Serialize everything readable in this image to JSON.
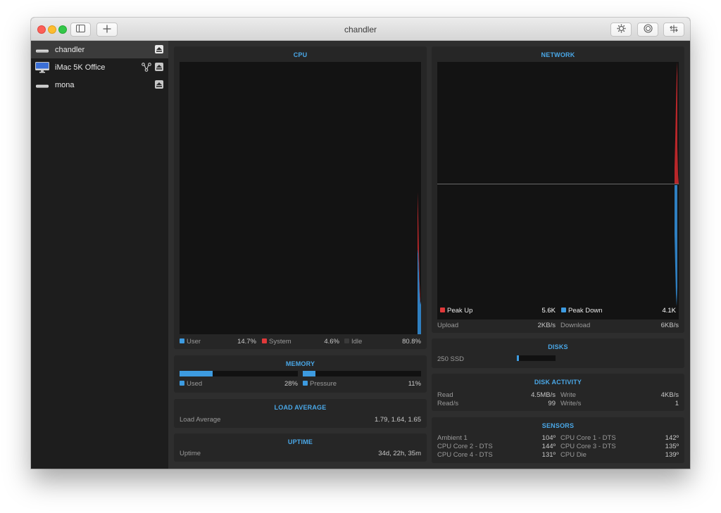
{
  "window": {
    "title": "chandler"
  },
  "sidebar": {
    "hosts": [
      {
        "name": "chandler",
        "selected": true
      },
      {
        "name": "iMac 5K Office",
        "selected": false
      },
      {
        "name": "mona",
        "selected": false
      }
    ]
  },
  "colors": {
    "accent": "#4aa8e8",
    "up_red": "#e0393a",
    "down_blue": "#3d9be0",
    "idle": "#3a3a3a"
  },
  "cpu": {
    "title": "CPU",
    "user_label": "User",
    "user_value": "14.7%",
    "system_label": "System",
    "system_value": "4.6%",
    "idle_label": "Idle",
    "idle_value": "80.8%"
  },
  "memory": {
    "title": "MEMORY",
    "used_label": "Used",
    "used_value": "28%",
    "used_fraction": 0.28,
    "pressure_label": "Pressure",
    "pressure_value": "11%",
    "pressure_fraction": 0.11
  },
  "load": {
    "title": "LOAD AVERAGE",
    "label": "Load Average",
    "value": "1.79, 1.64, 1.65"
  },
  "uptime": {
    "title": "UPTIME",
    "label": "Uptime",
    "value": "34d, 22h, 35m"
  },
  "network": {
    "title": "NETWORK",
    "peak_up_label": "Peak Up",
    "peak_up_value": "5.6K",
    "peak_down_label": "Peak Down",
    "peak_down_value": "4.1K",
    "upload_label": "Upload",
    "upload_value": "2KB/s",
    "download_label": "Download",
    "download_value": "6KB/s"
  },
  "disks": {
    "title": "DISKS",
    "disk_name": "250 SSD",
    "used_fraction": 0.06
  },
  "disk_activity": {
    "title": "DISK ACTIVITY",
    "read_label": "Read",
    "read_value": "4.5MB/s",
    "write_label": "Write",
    "write_value": "4KB/s",
    "reads_label": "Read/s",
    "reads_value": "99",
    "writes_label": "Write/s",
    "writes_value": "1"
  },
  "sensors": {
    "title": "SENSORS",
    "items": [
      {
        "label": "Ambient 1",
        "value": "104º"
      },
      {
        "label": "CPU Core 1 - DTS",
        "value": "142º"
      },
      {
        "label": "CPU Core 2 - DTS",
        "value": "144º"
      },
      {
        "label": "CPU Core 3 - DTS",
        "value": "135º"
      },
      {
        "label": "CPU Core 4 - DTS",
        "value": "131º"
      },
      {
        "label": "CPU Die",
        "value": "139º"
      }
    ]
  }
}
